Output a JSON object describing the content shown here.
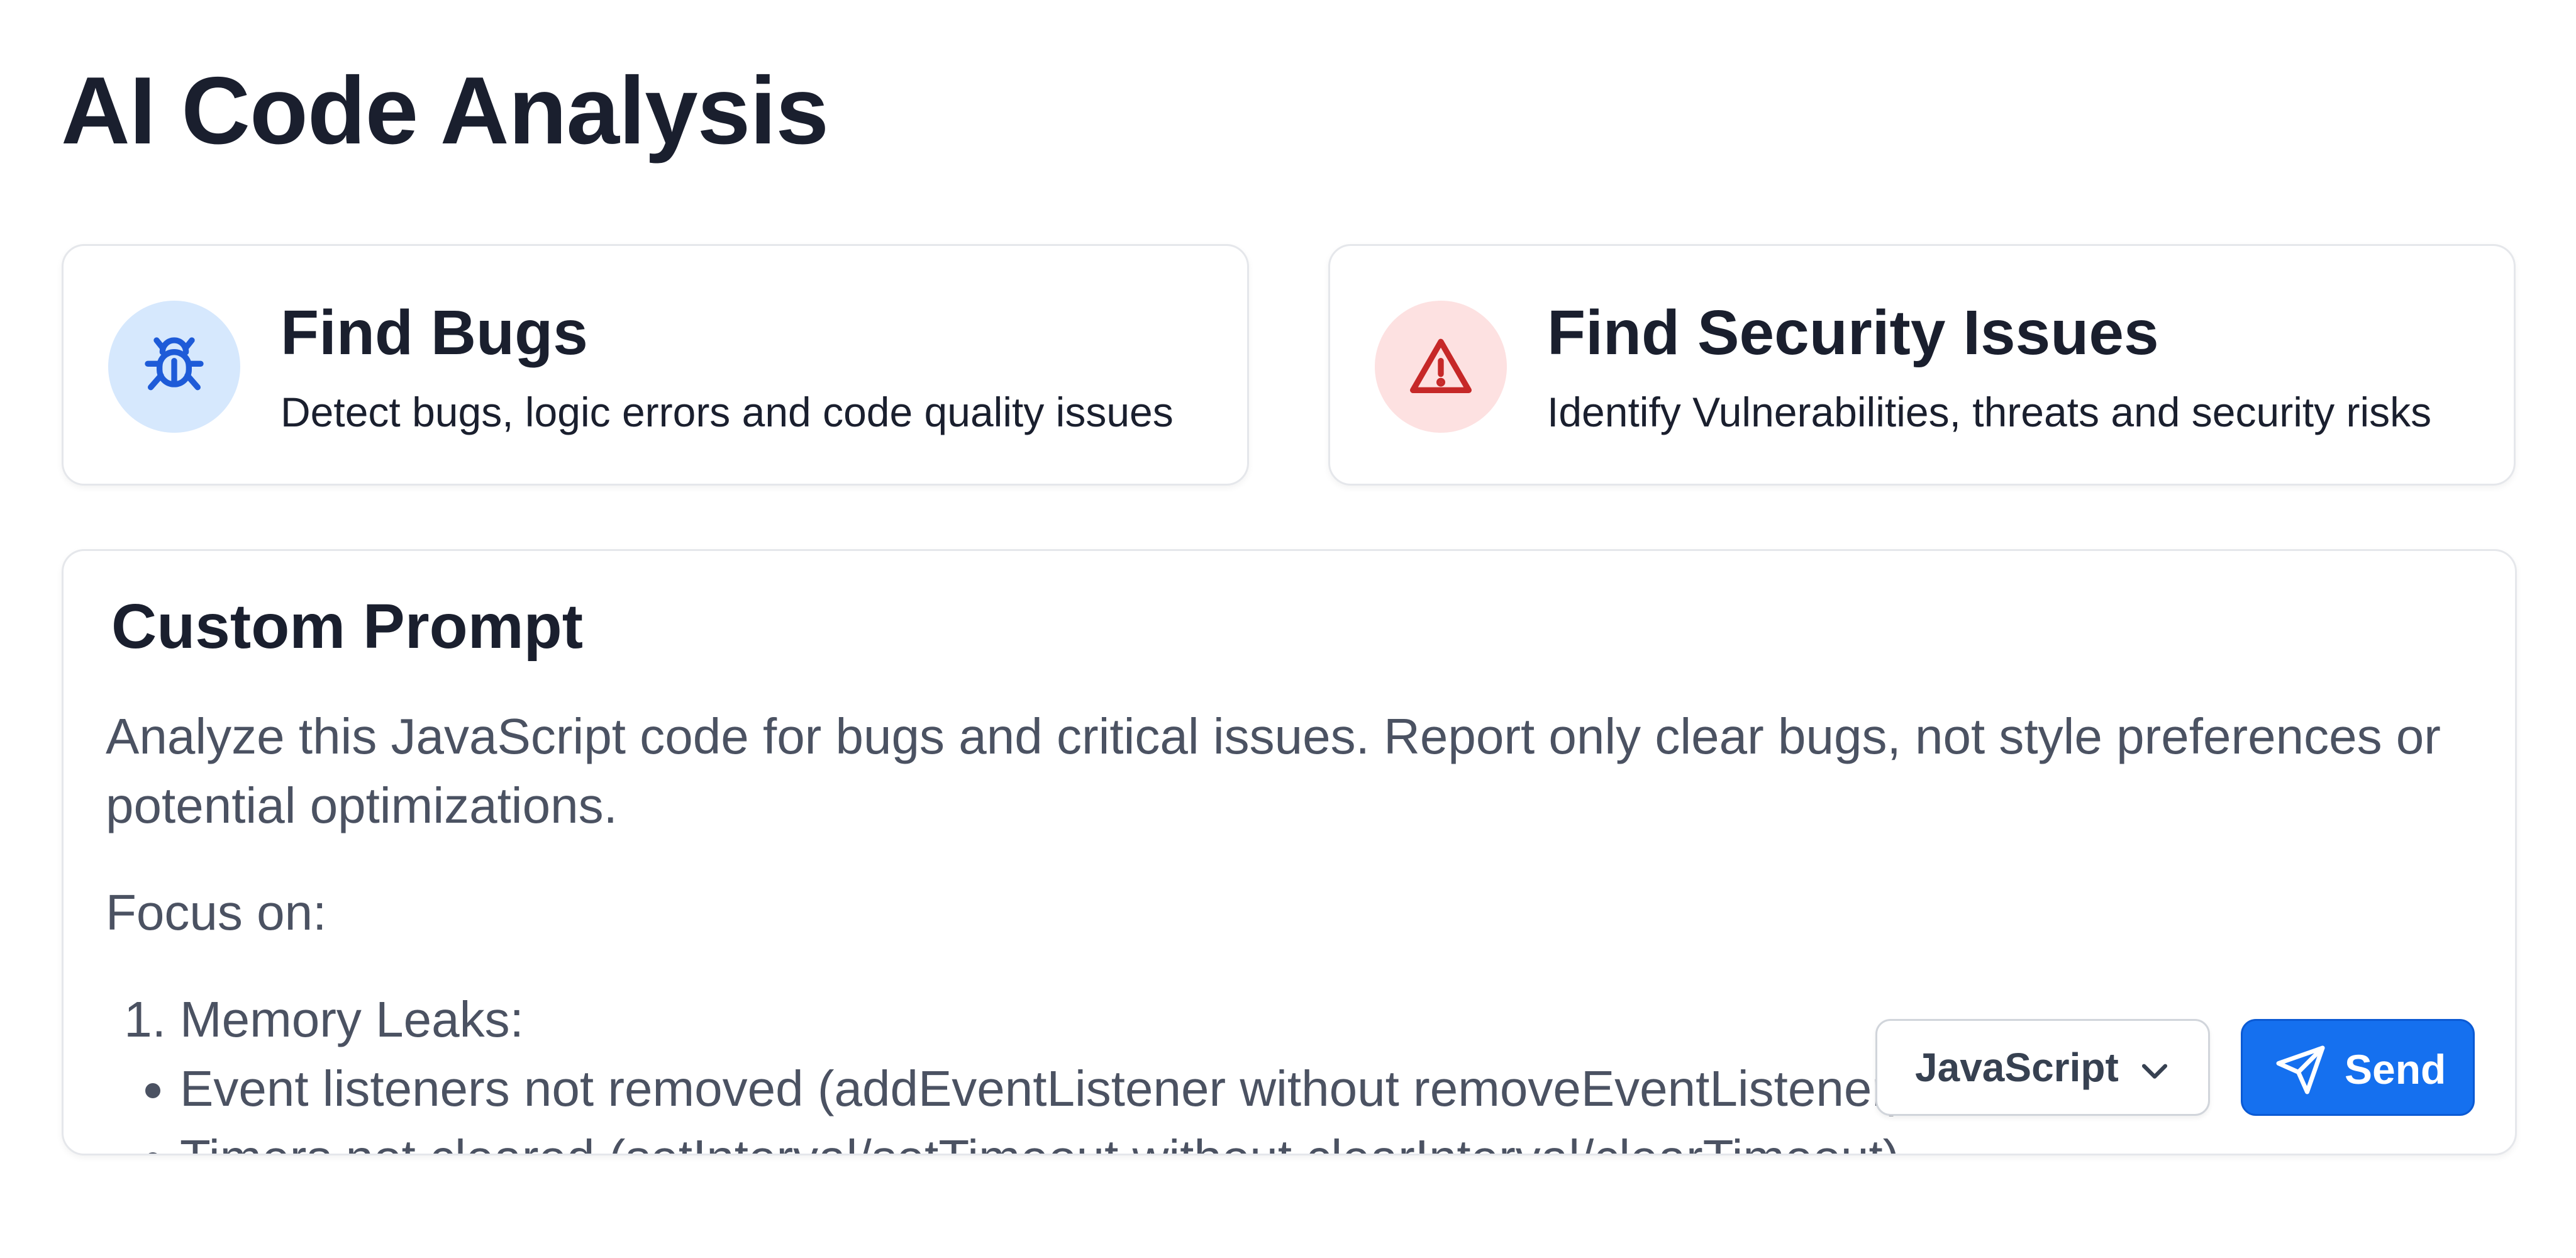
{
  "page": {
    "title": "AI Code Analysis"
  },
  "cards": [
    {
      "title": "Find Bugs",
      "description": "Detect bugs, logic errors and code quality issues",
      "icon": "bug-icon",
      "icon_color": "#1e5bd8",
      "icon_bg": "#d6e8fd"
    },
    {
      "title": "Find Security Issues",
      "description": "Identify Vulnerabilities, threats and security risks",
      "icon": "warning-icon",
      "icon_color": "#c62828",
      "icon_bg": "#fde1e1"
    }
  ],
  "custom_prompt": {
    "title": "Custom Prompt",
    "intro": "Analyze this JavaScript code for bugs and critical issues. Report only clear bugs, not style preferences or potential optimizations.",
    "focus_label": "Focus on:",
    "items": [
      {
        "number": "1.",
        "label": "Memory Leaks:",
        "bullets": [
          "Event listeners not removed (addEventListener without removeEventListener)",
          "Timers not cleared (setInterval/setTimeout without clearInterval/clearTimeout)"
        ]
      }
    ]
  },
  "controls": {
    "language": "JavaScript",
    "send_label": "Send"
  },
  "colors": {
    "accent": "#1570ef",
    "title_text": "#1a1f2e",
    "body_text": "#4b5262",
    "border": "#e5e7eb"
  }
}
